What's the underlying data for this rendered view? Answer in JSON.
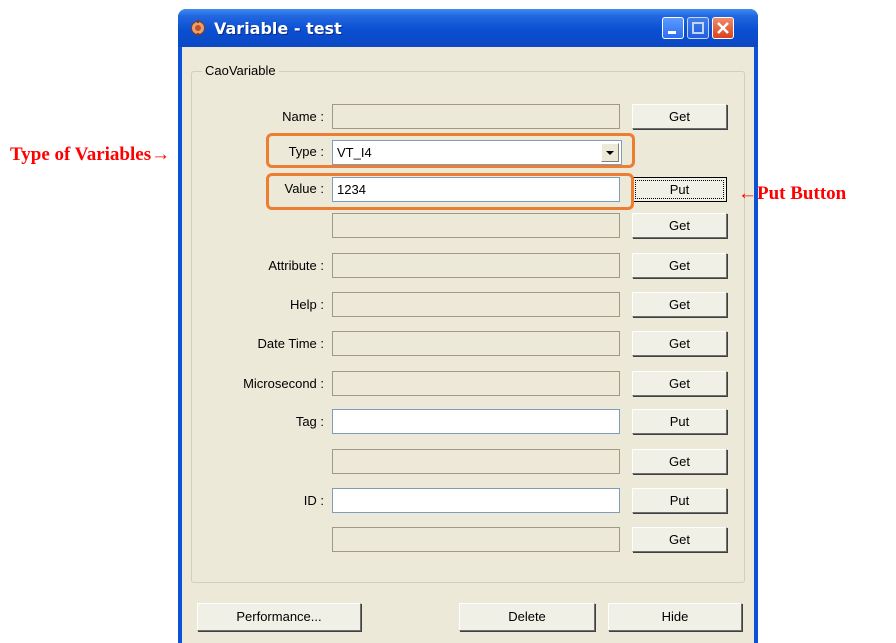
{
  "window": {
    "title": "Variable - test",
    "controls": [
      "minimize",
      "maximize",
      "close"
    ]
  },
  "group": {
    "legend": "CaoVariable"
  },
  "rows": [
    {
      "label": "Name :",
      "value": "",
      "button": "Get",
      "editable": false
    },
    {
      "label": "Type :",
      "value": "VT_I4",
      "control": "combo"
    },
    {
      "label": "Value :",
      "value": "1234",
      "button": "Put",
      "editable": true
    },
    {
      "label": "",
      "value": "",
      "button": "Get",
      "editable": false
    },
    {
      "label": "Attribute :",
      "value": "",
      "button": "Get",
      "editable": false
    },
    {
      "label": "Help :",
      "value": "",
      "button": "Get",
      "editable": false
    },
    {
      "label": "Date Time :",
      "value": "",
      "button": "Get",
      "editable": false
    },
    {
      "label": "Microsecond :",
      "value": "",
      "button": "Get",
      "editable": false
    },
    {
      "label": "Tag :",
      "value": "",
      "button": "Put",
      "editable": true
    },
    {
      "label": "",
      "value": "",
      "button": "Get",
      "editable": false
    },
    {
      "label": "ID :",
      "value": "",
      "button": "Put",
      "editable": true
    },
    {
      "label": "",
      "value": "",
      "button": "Get",
      "editable": false
    }
  ],
  "bottom_buttons": [
    "Performance...",
    "Delete",
    "Hide"
  ],
  "annotations": {
    "type_label": "Type  of  Variables→",
    "put_label": "←Put Button",
    "highlight_color": "#ed7d31",
    "text_color": "#ff0000"
  },
  "icons": [
    "app-gear-icon",
    "minimize-icon",
    "maximize-icon",
    "close-icon",
    "dropdown-arrow-icon"
  ]
}
